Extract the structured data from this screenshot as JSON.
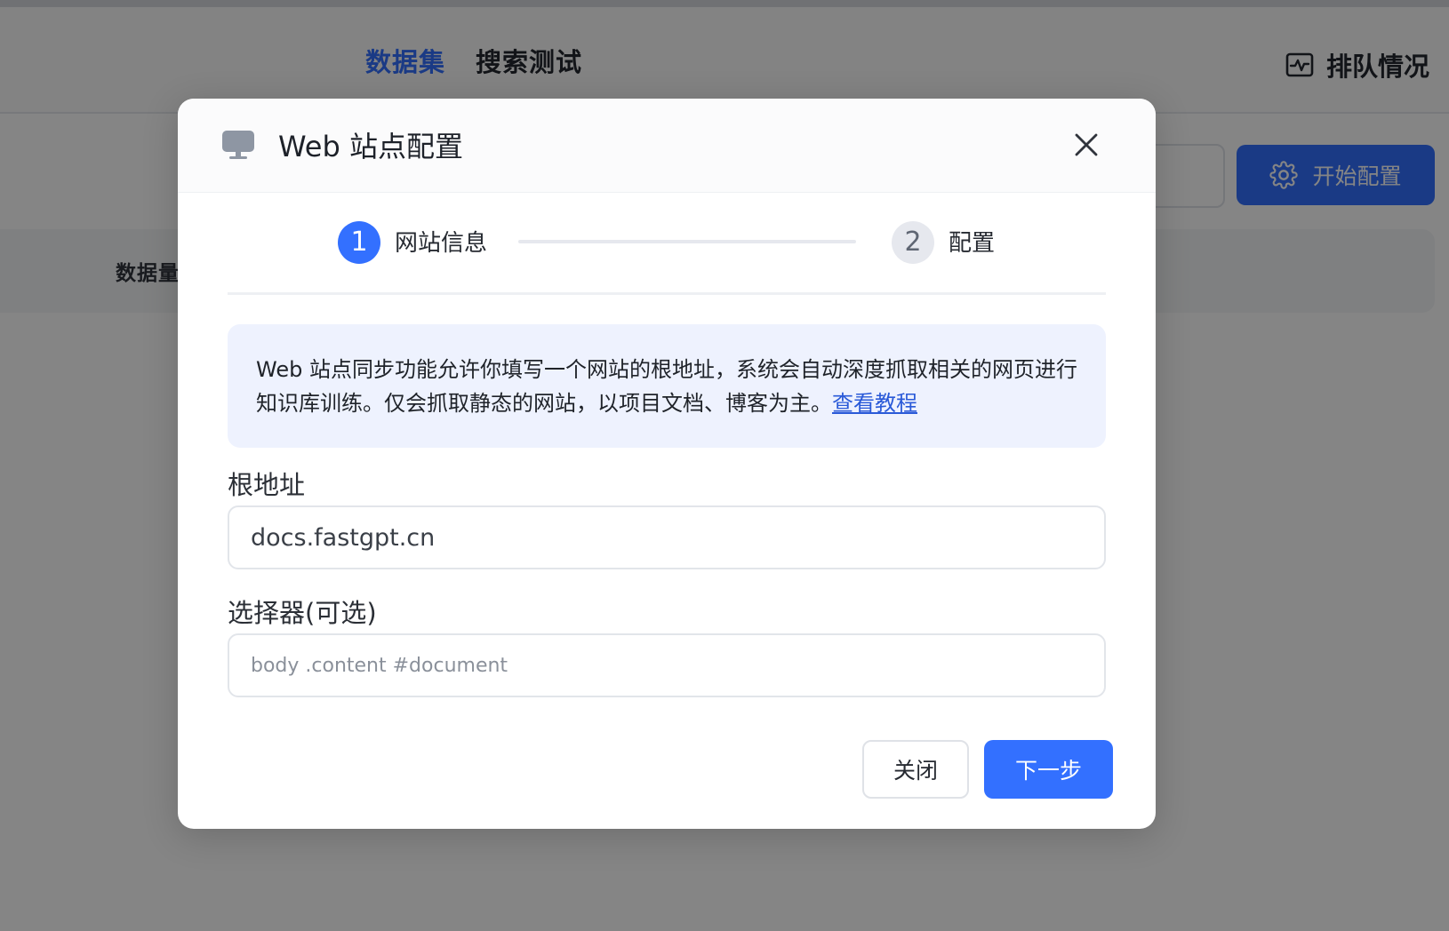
{
  "background": {
    "tabs": [
      {
        "label": "数据集",
        "active": true
      },
      {
        "label": "搜索测试",
        "active": false
      }
    ],
    "queue_label": "排队情况",
    "config_button_label": "开始配置",
    "column_label": "数据量"
  },
  "modal": {
    "title": "Web 站点配置",
    "steps": [
      {
        "number": "1",
        "label": "网站信息",
        "active": true
      },
      {
        "number": "2",
        "label": "配置",
        "active": false
      }
    ],
    "info_text": "Web 站点同步功能允许你填写一个网站的根地址，系统会自动深度抓取相关的网页进行知识库训练。仅会抓取静态的网站，以项目文档、博客为主。",
    "info_link": "查看教程",
    "root_label": "根地址",
    "root_value": "docs.fastgpt.cn",
    "selector_label": "选择器(可选)",
    "selector_placeholder": "body .content #document",
    "close_button_label": "关闭",
    "next_button_label": "下一步"
  },
  "colors": {
    "primary": "#3370ff",
    "info_background": "#eef2fe",
    "link": "#2a5ad8"
  },
  "icons": {
    "modal": "monitor-icon",
    "close": "close-icon",
    "queue": "activity-icon",
    "config": "gear-icon"
  }
}
